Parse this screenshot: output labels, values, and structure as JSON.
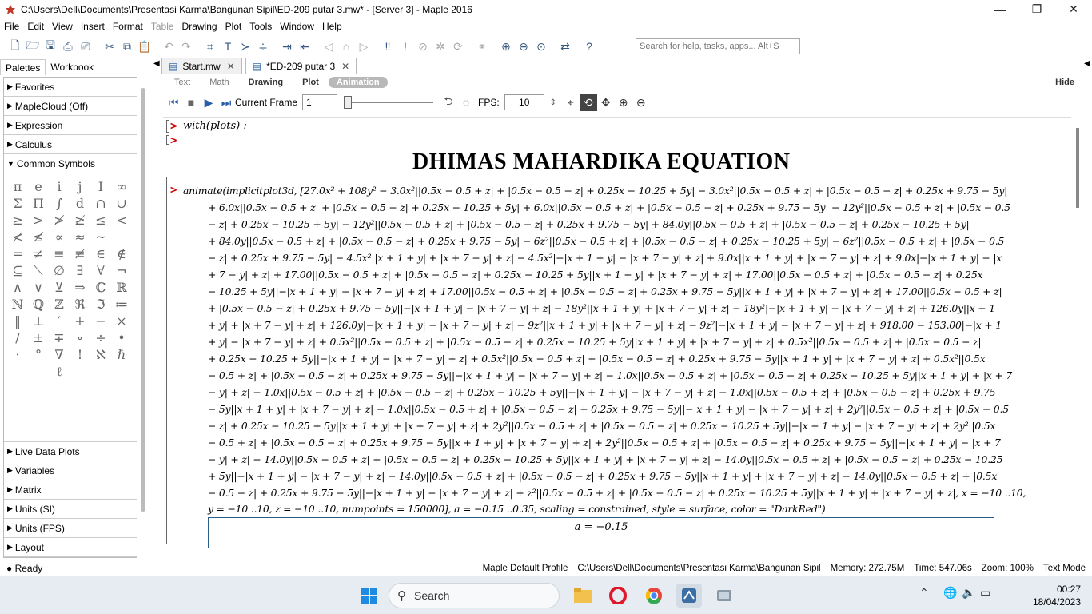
{
  "window": {
    "title": "C:\\Users\\Dell\\Documents\\Presentasi Karma\\Bangunan Sipil\\ED-209 putar 3.mw* - [Server 3] - Maple 2016",
    "minimize": "—",
    "restore": "❐",
    "close": "✕"
  },
  "menu": [
    "File",
    "Edit",
    "View",
    "Insert",
    "Format",
    "Table",
    "Drawing",
    "Plot",
    "Tools",
    "Window",
    "Help"
  ],
  "search": {
    "placeholder": "Search for help, tasks, apps... Alt+S"
  },
  "palette_tabs": {
    "palettes": "Palettes",
    "workbook": "Workbook"
  },
  "palettes": {
    "top": [
      "Favorites",
      "MapleCloud (Off)",
      "Expression",
      "Calculus"
    ],
    "open": "Common Symbols",
    "symbols": [
      "π",
      "e",
      "i",
      "j",
      "I",
      "∞",
      "Σ",
      "Π",
      "∫",
      "d",
      "∩",
      "∪",
      "≥",
      "&gt;",
      "≯",
      "≱",
      "≤",
      "&lt;",
      "≮",
      "≰",
      "∝",
      "≈",
      "~",
      "",
      "=",
      "≠",
      "≡",
      "≢",
      "∈",
      "∉",
      "⊆",
      "⟍",
      "∅",
      "∃",
      "∀",
      "¬",
      "∧",
      "∨",
      "⊻",
      "⇒",
      "ℂ",
      "ℝ",
      "ℕ",
      "ℚ",
      "ℤ",
      "ℜ",
      "ℑ",
      "≔",
      "‖",
      "⊥",
      "′",
      "+",
      "−",
      "×",
      "/",
      "±",
      "∓",
      "∘",
      "÷",
      "•",
      "·",
      "°",
      "∇",
      "!",
      "ℵ",
      "ℏ",
      "",
      "",
      "ℓ"
    ],
    "bottom": [
      "Live Data Plots",
      "Variables",
      "Matrix",
      "Units (SI)",
      "Units (FPS)",
      "Layout"
    ]
  },
  "status_left": "Ready",
  "doc_tabs": [
    {
      "label": "Start.mw",
      "active": false
    },
    {
      "label": "*ED-209 putar 3",
      "active": true
    }
  ],
  "context_tabs": {
    "text": "Text",
    "math": "Math",
    "drawing": "Drawing",
    "plot": "Plot",
    "animation": "Animation",
    "hide": "Hide"
  },
  "animation": {
    "current_frame_label": "Current Frame",
    "current_frame": "1",
    "fps_label": "FPS:",
    "fps": "10"
  },
  "worksheet": {
    "line1": "with(plots) :",
    "heading": "DHIMAS MAHARDIKA EQUATION",
    "cmd_start": "animate(implicitplot3d, [27.0x² + 108y² − 3.0x²||0.5x − 0.5 + z| + |0.5x − 0.5 − z| + 0.25x − 10.25 + 5y| − 3.0x²||0.5x − 0.5 + z| + |0.5x − 0.5 − z| + 0.25x + 9.75 − 5y|",
    "eq_lines": [
      "+ 6.0x||0.5x − 0.5 + z| + |0.5x − 0.5 − z| + 0.25x − 10.25 + 5y| + 6.0x||0.5x − 0.5 + z| + |0.5x − 0.5 − z| + 0.25x + 9.75 − 5y| − 12y²||0.5x − 0.5 + z| + |0.5x − 0.5",
      "− z| + 0.25x − 10.25 + 5y| − 12y²||0.5x − 0.5 + z| + |0.5x − 0.5 − z| + 0.25x + 9.75 − 5y| + 84.0y||0.5x − 0.5 + z| + |0.5x − 0.5 − z| + 0.25x − 10.25 + 5y|",
      "+ 84.0y||0.5x − 0.5 + z| + |0.5x − 0.5 − z| + 0.25x + 9.75 − 5y| − 6z²||0.5x − 0.5 + z| + |0.5x − 0.5 − z| + 0.25x − 10.25 + 5y| − 6z²||0.5x − 0.5 + z| + |0.5x − 0.5",
      "− z| + 0.25x + 9.75 − 5y| − 4.5x²||x + 1 + y| + |x + 7 − y| + z| − 4.5x²|−|x + 1 + y| − |x + 7 − y| + z| + 9.0x||x + 1 + y| + |x + 7 − y| + z| + 9.0x|−|x + 1 + y| − |x",
      "+ 7 − y| + z| + 17.00||0.5x − 0.5 + z| + |0.5x − 0.5 − z| + 0.25x − 10.25 + 5y||x + 1 + y| + |x + 7 − y| + z| + 17.00||0.5x − 0.5 + z| + |0.5x − 0.5 − z| + 0.25x",
      "− 10.25 + 5y||−|x + 1 + y| − |x + 7 − y| + z| + 17.00||0.5x − 0.5 + z| + |0.5x − 0.5 − z| + 0.25x + 9.75 − 5y||x + 1 + y| + |x + 7 − y| + z| + 17.00||0.5x − 0.5 + z|",
      "+ |0.5x − 0.5 − z| + 0.25x + 9.75 − 5y||−|x + 1 + y| − |x + 7 − y| + z| − 18y²||x + 1 + y| + |x + 7 − y| + z| − 18y²|−|x + 1 + y| − |x + 7 − y| + z| + 126.0y||x + 1",
      "+ y| + |x + 7 − y| + z| + 126.0y|−|x + 1 + y| − |x + 7 − y| + z| − 9z²||x + 1 + y| + |x + 7 − y| + z| − 9z²|−|x + 1 + y| − |x + 7 − y| + z| + 918.00 − 153.00|−|x + 1",
      "+ y| − |x + 7 − y| + z| + 0.5x²||0.5x − 0.5 + z| + |0.5x − 0.5 − z| + 0.25x − 10.25 + 5y||x + 1 + y| + |x + 7 − y| + z| + 0.5x²||0.5x − 0.5 + z| + |0.5x − 0.5 − z|",
      "+ 0.25x − 10.25 + 5y||−|x + 1 + y| − |x + 7 − y| + z| + 0.5x²||0.5x − 0.5 + z| + |0.5x − 0.5 − z| + 0.25x + 9.75 − 5y||x + 1 + y| + |x + 7 − y| + z| + 0.5x²||0.5x",
      "− 0.5 + z| + |0.5x − 0.5 − z| + 0.25x + 9.75 − 5y||−|x + 1 + y| − |x + 7 − y| + z| − 1.0x||0.5x − 0.5 + z| + |0.5x − 0.5 − z| + 0.25x − 10.25 + 5y||x + 1 + y| + |x + 7",
      "− y| + z| − 1.0x||0.5x − 0.5 + z| + |0.5x − 0.5 − z| + 0.25x − 10.25 + 5y||−|x + 1 + y| − |x + 7 − y| + z| − 1.0x||0.5x − 0.5 + z| + |0.5x − 0.5 − z| + 0.25x + 9.75",
      "− 5y||x + 1 + y| + |x + 7 − y| + z| − 1.0x||0.5x − 0.5 + z| + |0.5x − 0.5 − z| + 0.25x + 9.75 − 5y||−|x + 1 + y| − |x + 7 − y| + z| + 2y²||0.5x − 0.5 + z| + |0.5x − 0.5",
      "− z| + 0.25x − 10.25 + 5y||x + 1 + y| + |x + 7 − y| + z| + 2y²||0.5x − 0.5 + z| + |0.5x − 0.5 − z| + 0.25x − 10.25 + 5y||−|x + 1 + y| − |x + 7 − y| + z| + 2y²||0.5x",
      "− 0.5 + z| + |0.5x − 0.5 − z| + 0.25x + 9.75 − 5y||x + 1 + y| + |x + 7 − y| + z| + 2y²||0.5x − 0.5 + z| + |0.5x − 0.5 − z| + 0.25x + 9.75 − 5y||−|x + 1 + y| − |x + 7",
      "− y| + z| − 14.0y||0.5x − 0.5 + z| + |0.5x − 0.5 − z| + 0.25x − 10.25 + 5y||x + 1 + y| + |x + 7 − y| + z| − 14.0y||0.5x − 0.5 + z| + |0.5x − 0.5 − z| + 0.25x − 10.25",
      "+ 5y||−|x + 1 + y| − |x + 7 − y| + z| − 14.0y||0.5x − 0.5 + z| + |0.5x − 0.5 − z| + 0.25x + 9.75 − 5y||x + 1 + y| + |x + 7 − y| + z| − 14.0y||0.5x − 0.5 + z| + |0.5x",
      "− 0.5 − z| + 0.25x + 9.75 − 5y||−|x + 1 + y| − |x + 7 − y| + z| + z²||0.5x − 0.5 + z| + |0.5x − 0.5 − z| + 0.25x − 10.25 + 5y||x + 1 + y| + |x + 7 − y| + z|, x = −10 ..10,"
    ],
    "cmd_end": "y = −10 ..10, z = −10 ..10, numpoints = 150000], a = −0.15 ..0.35, scaling = constrained, style = surface, color = \"DarkRed\")",
    "plot_label": "a = −0.15"
  },
  "statusbar": {
    "profile": "Maple Default Profile",
    "path": "C:\\Users\\Dell\\Documents\\Presentasi Karma\\Bangunan Sipil",
    "memory": "Memory: 272.75M",
    "time": "Time: 547.06s",
    "zoom": "Zoom: 100%",
    "mode": "Text Mode"
  },
  "taskbar": {
    "search": "Search",
    "time": "00:27",
    "date": "18/04/2023"
  }
}
